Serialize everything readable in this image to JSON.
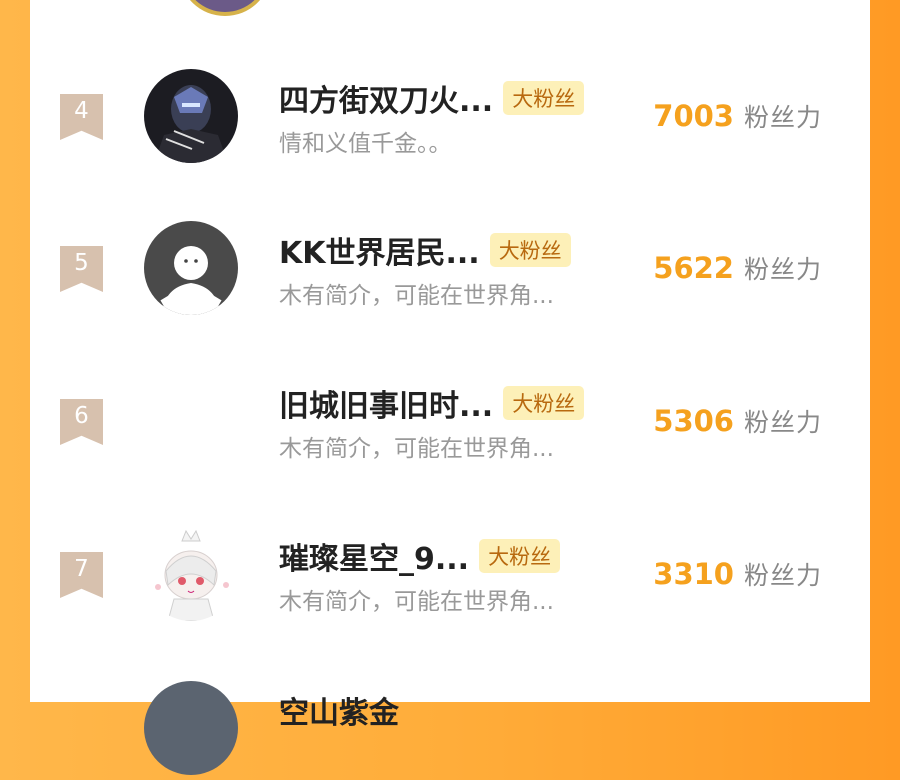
{
  "rows": [
    {
      "rank": "4",
      "name": "四方街双刀火...",
      "badge": "大粉丝",
      "bio": "情和义值千金。。",
      "score": "7003",
      "score_label": "粉丝力"
    },
    {
      "rank": "5",
      "name": "KK世界居民...",
      "badge": "大粉丝",
      "bio": "木有简介，可能在世界角...",
      "score": "5622",
      "score_label": "粉丝力"
    },
    {
      "rank": "6",
      "name": "旧城旧事旧时...",
      "badge": "大粉丝",
      "bio": "木有简介，可能在世界角...",
      "score": "5306",
      "score_label": "粉丝力"
    },
    {
      "rank": "7",
      "name": "璀璨星空_9...",
      "badge": "大粉丝",
      "bio": "木有简介，可能在世界角...",
      "score": "3310",
      "score_label": "粉丝力"
    },
    {
      "rank": "",
      "name": "空山紫金",
      "badge": "",
      "bio": "",
      "score": "",
      "score_label": ""
    }
  ],
  "colors": {
    "accent": "#f5a11e",
    "badge_bg": "#fdf0b8",
    "rank_bg": "#d7c1ae",
    "page_bg": "#ffad3a"
  }
}
